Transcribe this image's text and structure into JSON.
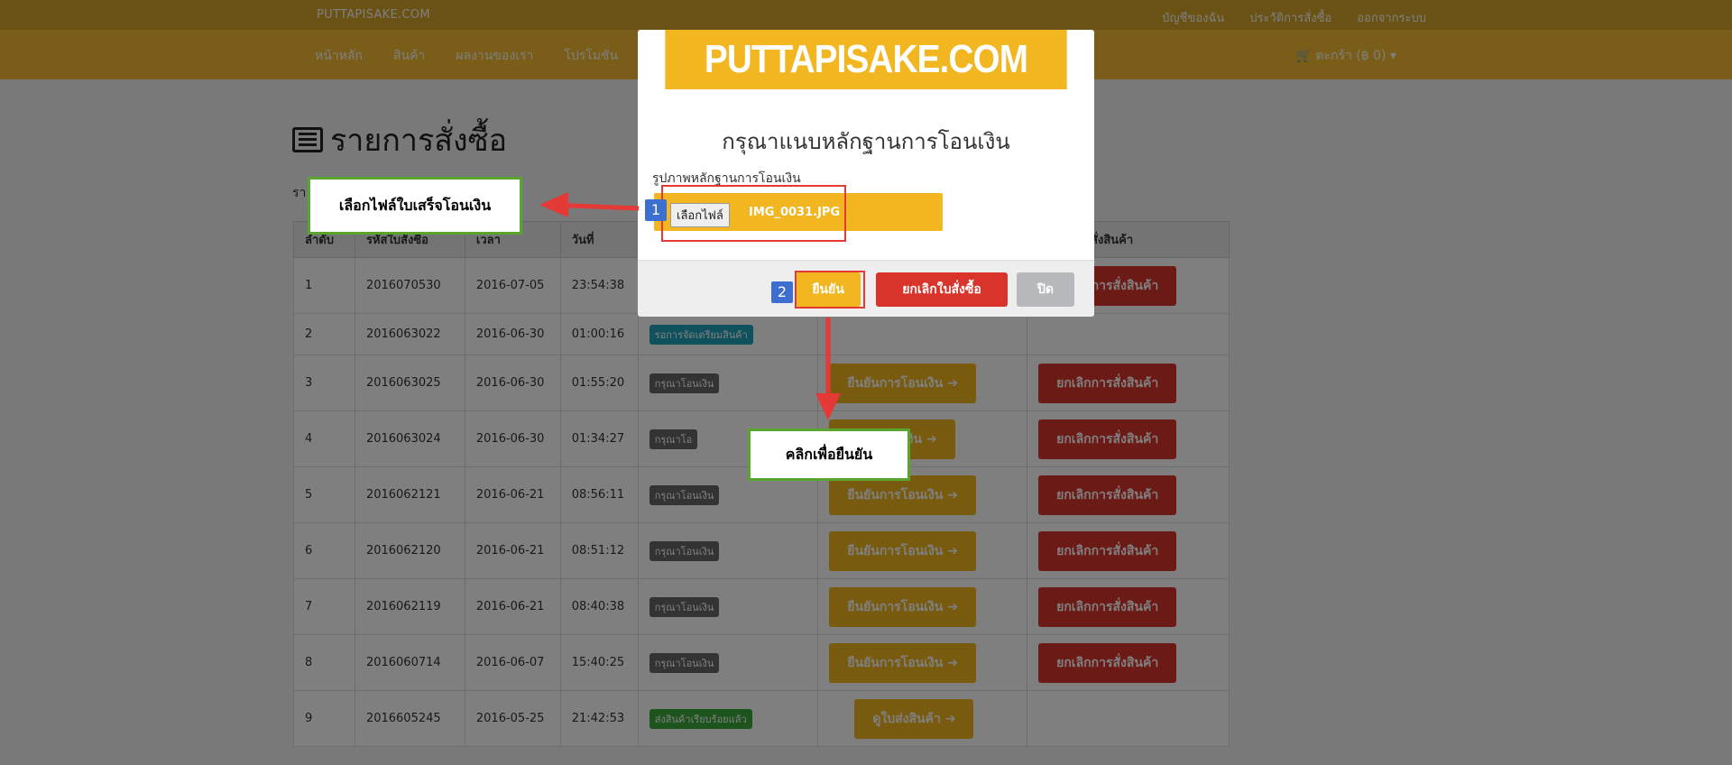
{
  "topbar": {
    "brand": "PUTTAPISAKE.COM",
    "links": [
      "บัญชีของฉัน",
      "ประวัติการสั่งซื้อ",
      "ออกจากระบบ"
    ]
  },
  "navbar": {
    "links": [
      "หน้าหลัก",
      "สินค้า",
      "ผลงานของเรา",
      "โปรโมชั่น"
    ],
    "cart": "ตะกร้า (฿ 0)"
  },
  "page": {
    "title": "รายการสั่งซื้อ",
    "subtitle": "รา"
  },
  "table": {
    "headers": [
      "ลำดับ",
      "รหัสใบสั่งซื้อ",
      "เวลา",
      "วันที่",
      "",
      "",
      "ยกเลิกการสั่งสินค้า"
    ],
    "rows": [
      {
        "no": "1",
        "code": "2016070530",
        "date": "2016-07-05",
        "time": "23:54:38",
        "status": "",
        "action": "",
        "cancel": "ยกเลิกการสั่งสินค้า"
      },
      {
        "no": "2",
        "code": "2016063022",
        "date": "2016-06-30",
        "time": "01:00:16",
        "status": "รอการจัดเตรียมสินค้า",
        "action": "",
        "cancel": ""
      },
      {
        "no": "3",
        "code": "2016063025",
        "date": "2016-06-30",
        "time": "01:55:20",
        "status": "กรุณาโอนเงิน",
        "action": "ยืนยันการโอนเงิน",
        "cancel": "ยกเลิกการสั่งสินค้า"
      },
      {
        "no": "4",
        "code": "2016063024",
        "date": "2016-06-30",
        "time": "01:34:27",
        "status": "กรุณาโอ",
        "action": "นเงิน",
        "cancel": "ยกเลิกการสั่งสินค้า"
      },
      {
        "no": "5",
        "code": "2016062121",
        "date": "2016-06-21",
        "time": "08:56:11",
        "status": "กรุณาโอนเงิน",
        "action": "ยืนยันการโอนเงิน",
        "cancel": "ยกเลิกการสั่งสินค้า"
      },
      {
        "no": "6",
        "code": "2016062120",
        "date": "2016-06-21",
        "time": "08:51:12",
        "status": "กรุณาโอนเงิน",
        "action": "ยืนยันการโอนเงิน",
        "cancel": "ยกเลิกการสั่งสินค้า"
      },
      {
        "no": "7",
        "code": "2016062119",
        "date": "2016-06-21",
        "time": "08:40:38",
        "status": "กรุณาโอนเงิน",
        "action": "ยืนยันการโอนเงิน",
        "cancel": "ยกเลิกการสั่งสินค้า"
      },
      {
        "no": "8",
        "code": "2016060714",
        "date": "2016-06-07",
        "time": "15:40:25",
        "status": "กรุณาโอนเงิน",
        "action": "ยืนยันการโอนเงิน",
        "cancel": "ยกเลิกการสั่งสินค้า"
      },
      {
        "no": "9",
        "code": "2016605245",
        "date": "2016-05-25",
        "time": "21:42:53",
        "status": "ส่งสินค้าเรียบร้อยแล้ว",
        "action": "ดูใบส่งสินค้า",
        "cancel": ""
      }
    ]
  },
  "modal": {
    "brand": "PUTTAPISAKE.COM",
    "close": "×",
    "heading": "กรุณาแนบหลักฐานการโอนเงิน",
    "label": "รูปภาพหลักฐานการโอนเงิน",
    "file_button": "เลือกไฟล์",
    "file_name": "IMG_0031.JPG",
    "confirm": "ยืนยัน",
    "cancel_order": "ยกเลิกใบสั่งซื้อ",
    "close_btn": "ปิด"
  },
  "annotations": {
    "step1": "1",
    "step2": "2",
    "callout_file": "เลือกไฟล์ใบเสร็จโอนเงิน",
    "callout_confirm": "คลิกเพื่อยืนยัน"
  },
  "colors": {
    "accent": "#f2b620",
    "danger": "#d9342b",
    "callout_border": "#5aa530",
    "annotation_red": "#e53935",
    "step_tag": "#3d6fd1"
  }
}
